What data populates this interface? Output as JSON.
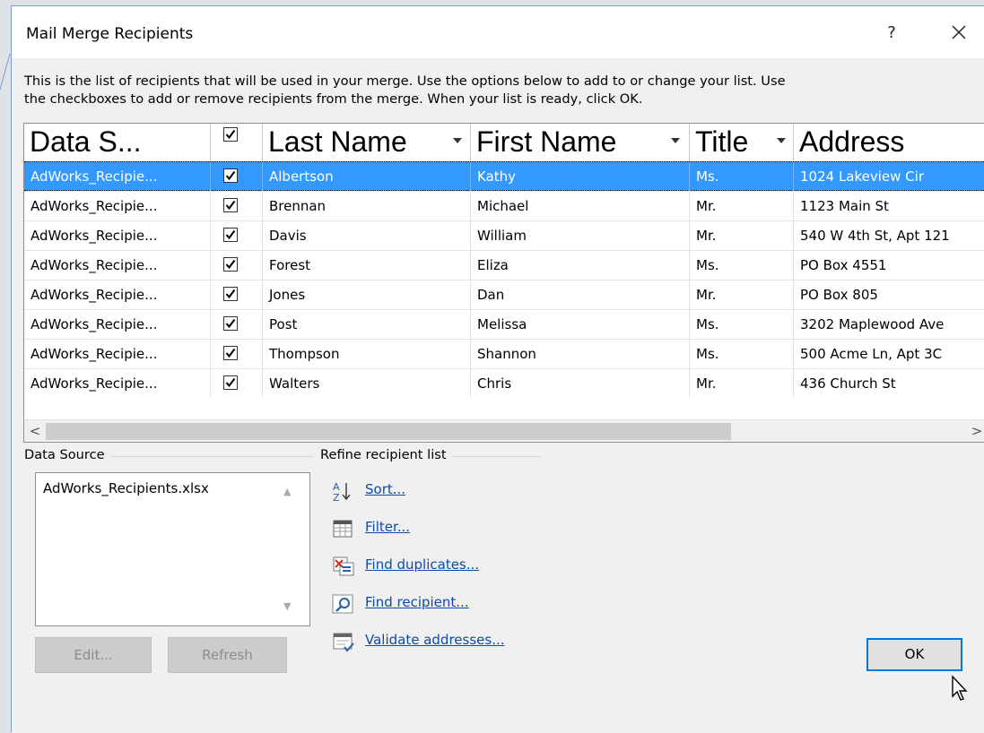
{
  "window": {
    "title": "Mail Merge Recipients",
    "help_label": "?",
    "close_icon": "close-icon"
  },
  "intro": {
    "line1": "This is the list of recipients that will be used in your merge.  Use the options below to add to or change your list.  Use",
    "line2": "the checkboxes to add or remove recipients from the merge.  When your list is ready, click OK."
  },
  "table": {
    "columns": [
      {
        "label": "Data S..."
      },
      {
        "label": ""
      },
      {
        "label": "Last Name"
      },
      {
        "label": "First Name"
      },
      {
        "label": "Title"
      },
      {
        "label": "Address"
      }
    ],
    "rows": [
      {
        "source": "AdWorks_Recipie...",
        "checked": true,
        "last": "Albertson",
        "first": "Kathy",
        "title": "Ms.",
        "address": "1024 Lakeview Cir",
        "selected": true
      },
      {
        "source": "AdWorks_Recipie...",
        "checked": true,
        "last": "Brennan",
        "first": "Michael",
        "title": "Mr.",
        "address": "1123 Main St",
        "selected": false
      },
      {
        "source": "AdWorks_Recipie...",
        "checked": true,
        "last": "Davis",
        "first": "William",
        "title": "Mr.",
        "address": "540 W 4th St, Apt 121",
        "selected": false
      },
      {
        "source": "AdWorks_Recipie...",
        "checked": true,
        "last": "Forest",
        "first": "Eliza",
        "title": "Ms.",
        "address": "PO Box 4551",
        "selected": false
      },
      {
        "source": "AdWorks_Recipie...",
        "checked": true,
        "last": "Jones",
        "first": "Dan",
        "title": "Mr.",
        "address": "PO Box 805",
        "selected": false
      },
      {
        "source": "AdWorks_Recipie...",
        "checked": true,
        "last": "Post",
        "first": "Melissa",
        "title": "Ms.",
        "address": "3202 Maplewood Ave",
        "selected": false
      },
      {
        "source": "AdWorks_Recipie...",
        "checked": true,
        "last": "Thompson",
        "first": "Shannon",
        "title": "Ms.",
        "address": "500 Acme Ln, Apt 3C",
        "selected": false
      },
      {
        "source": "AdWorks_Recipie...",
        "checked": true,
        "last": "Walters",
        "first": "Chris",
        "title": "Mr.",
        "address": "436 Church St",
        "selected": false
      }
    ],
    "scroll_left": "<",
    "scroll_right": ">"
  },
  "data_source": {
    "group_label": "Data Source",
    "items": [
      "AdWorks_Recipients.xlsx"
    ],
    "edit_label": "Edit...",
    "refresh_label": "Refresh"
  },
  "refine": {
    "group_label": "Refine recipient list",
    "links": [
      {
        "label": "Sort...",
        "icon": "sort-az-icon"
      },
      {
        "label": "Filter...",
        "icon": "filter-icon"
      },
      {
        "label": "Find duplicates...",
        "icon": "find-duplicates-icon"
      },
      {
        "label": "Find recipient...",
        "icon": "find-recipient-icon"
      },
      {
        "label": "Validate addresses...",
        "icon": "validate-addresses-icon"
      }
    ]
  },
  "ok_label": "OK",
  "colors": {
    "selection": "#3399ff",
    "link": "#0e4aa8",
    "ok_border": "#0078d7",
    "dialog_bg": "#f0f0f0"
  }
}
